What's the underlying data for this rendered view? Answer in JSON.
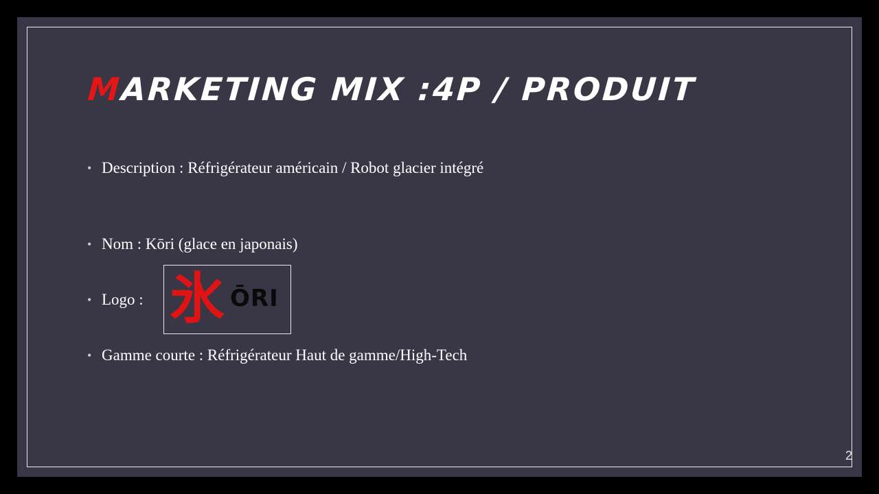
{
  "slide": {
    "title_first_letter": "M",
    "title_rest": "arketing Mix :4P / Produit",
    "bullet_char": "•",
    "bullets": [
      {
        "text": "Description : Réfrigérateur américain / Robot glacier intégré"
      },
      {
        "text": "Nom : Kōri (glace en japonais)"
      },
      {
        "text": "Logo :"
      },
      {
        "text": "Gamme courte : Réfrigérateur Haut de gamme/High-Tech"
      }
    ],
    "logo": {
      "kanji": "氷",
      "word": "ŌRI"
    },
    "page_number": "2"
  },
  "colors": {
    "background": "#393646",
    "accent_red": "#e51616",
    "text": "#ffffff"
  }
}
